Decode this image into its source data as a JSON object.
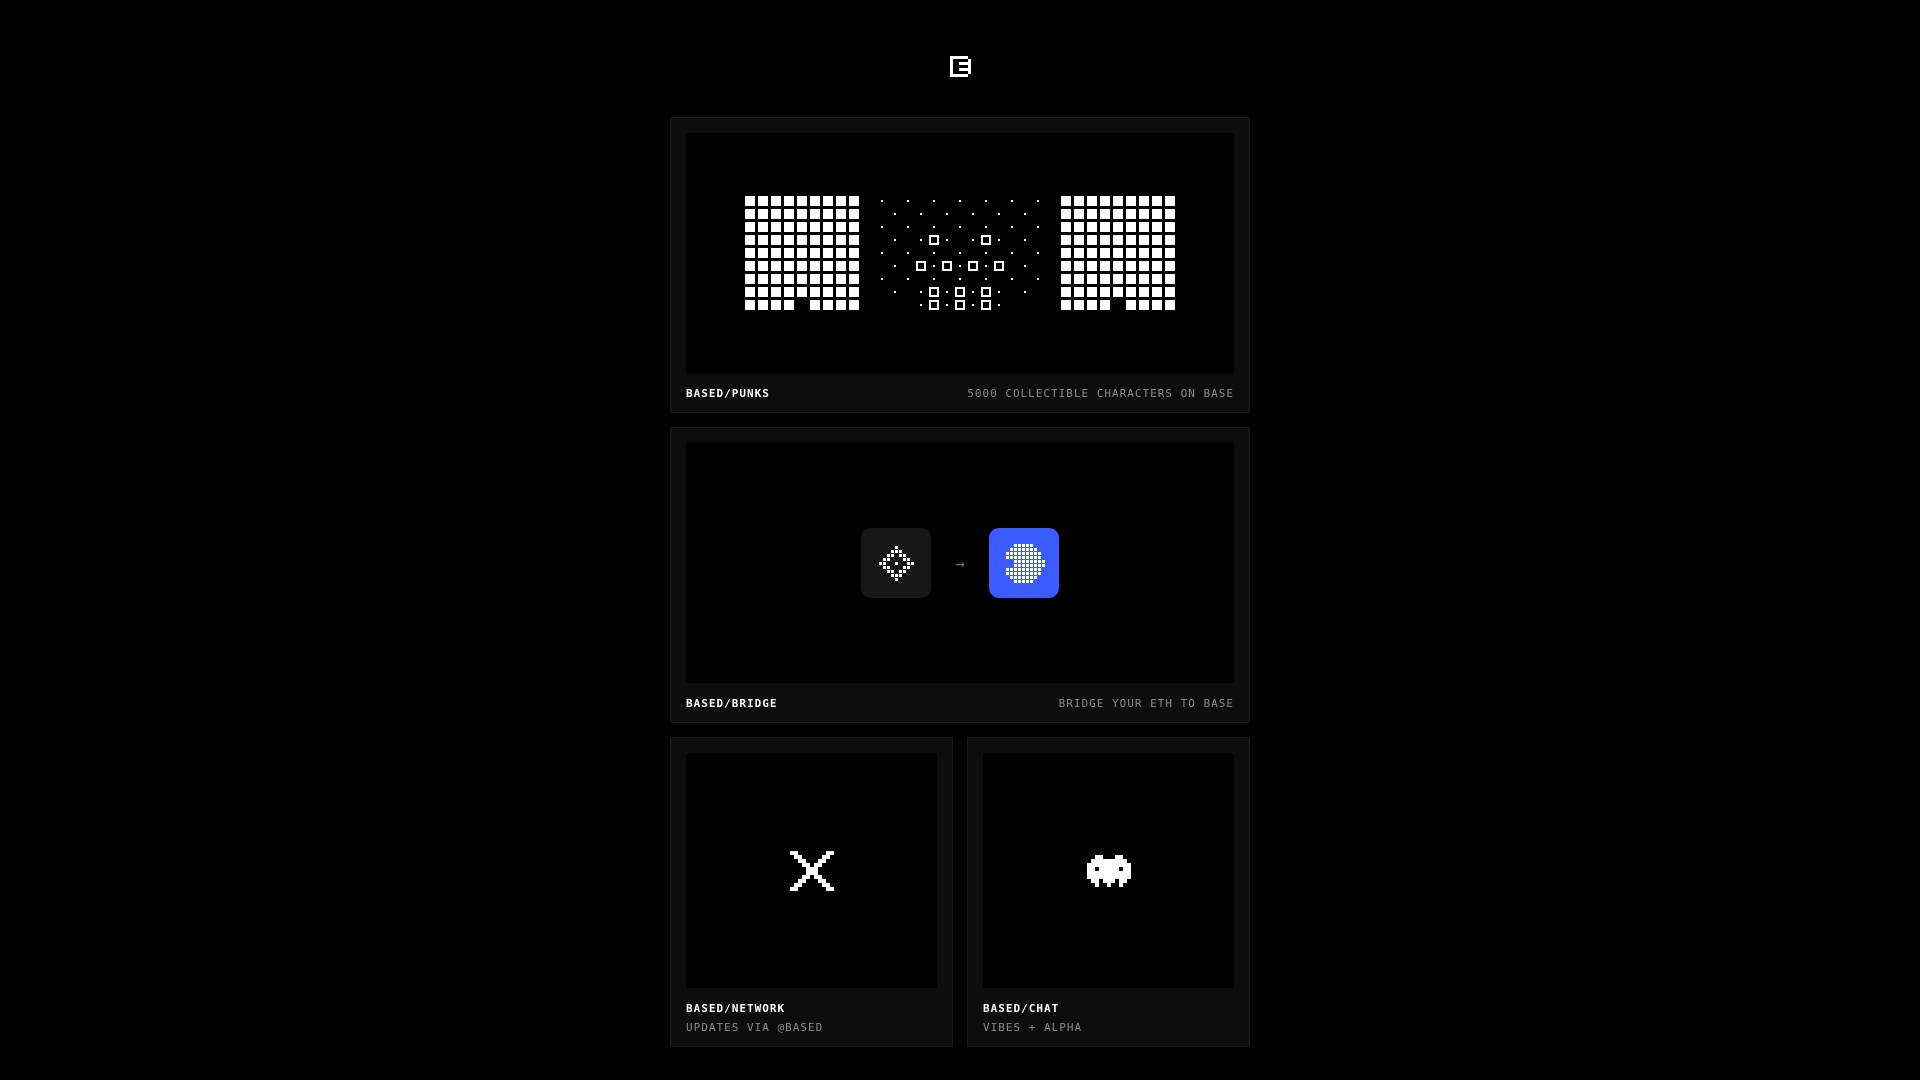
{
  "cards": {
    "punks": {
      "title": "BASED/PUNKS",
      "sub": "5000 COLLECTIBLE CHARACTERS ON BASE"
    },
    "bridge": {
      "title": "BASED/BRIDGE",
      "sub": "BRIDGE YOUR ETH TO BASE"
    },
    "network": {
      "title": "BASED/NETWORK",
      "sub": "UPDATES VIA @BASED"
    },
    "chat": {
      "title": "BASED/CHAT",
      "sub": "VIBES + ALPHA"
    }
  },
  "icons": {
    "punks_solid": [
      "#########",
      "#########",
      "#########",
      "#########",
      "#########",
      "#########",
      "#########",
      "#########",
      "#### ####"
    ],
    "punks_mid": [
      ". . . . . . .",
      " . . . . . . ",
      ". . . . . . .",
      " . .o. .o. . ",
      ". . . . . . .",
      " . o.o.o.o . ",
      ". . . . . . .",
      " . .o.o.o. . ",
      "   .o.o.o.   "
    ],
    "eth": [
      "    #    ",
      "   ###   ",
      "  ## ##  ",
      " ##   ## ",
      "##  #  ##",
      " ##   ## ",
      "  ## ##  ",
      "   ###   ",
      "    #    "
    ],
    "base": [
      "   #####   ",
      "  #######  ",
      " ######### ",
      " ######### ",
      "   ########",
      "   ########",
      " ######### ",
      " ######### ",
      "  #######  ",
      "   #####   "
    ],
    "x": [
      "##       ##",
      " ##     ## ",
      "  ##   ##  ",
      "   ## ##   ",
      "    ###    ",
      "    ###    ",
      "   ## ##   ",
      "  ##   ##  ",
      " ##     ## ",
      "##       ##"
    ],
    "alien": [
      "   ##   ##   ",
      "  #########  ",
      " ########### ",
      " ## ##### ## ",
      " ########### ",
      " ########### ",
      "  ## ### ##  ",
      "   #  #  #   "
    ],
    "logo": [
      "###### ",
      "#     #",
      "#  ####",
      "#     #",
      "#  ####",
      "#     #",
      "###### "
    ]
  }
}
